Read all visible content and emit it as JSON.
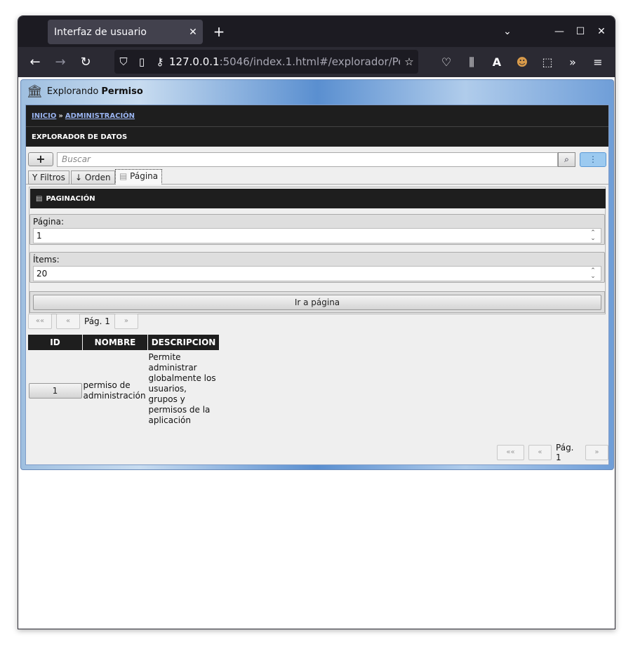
{
  "browser": {
    "tab_title": "Interfaz de usuario",
    "tab_close": "✕",
    "new_tab": "+",
    "url_host": "127.0.0.1",
    "url_rest": ":5046/index.1.html#/explorador/Pe"
  },
  "app": {
    "header_prefix": "Explorando",
    "header_entity": "Permiso",
    "breadcrumb": {
      "home": "INICIO",
      "separator": "»",
      "section": "ADMINISTRACIÓN"
    },
    "section_title": "EXPLORADOR DE DATOS",
    "search": {
      "add_label": "+",
      "placeholder": "Buscar",
      "more_label": "⋮"
    },
    "tabs": [
      {
        "label": "Filtros",
        "icon": "Y"
      },
      {
        "label": "Orden",
        "icon": "↓"
      },
      {
        "label": "Página",
        "icon": "▤"
      }
    ],
    "pagination": {
      "title": "PAGINACIÓN",
      "page_label": "Página:",
      "page_value": "1",
      "items_label": "Ítems:",
      "items_value": "20",
      "go_label": "Ir a página"
    },
    "pager": {
      "first": "««",
      "prev": "«",
      "current": "Pág. 1",
      "next": "»"
    },
    "table": {
      "columns": [
        "ID",
        "NOMBRE",
        "DESCRIPCION"
      ],
      "rows": [
        {
          "id": "1",
          "nombre_lines": [
            "permiso de",
            "administración"
          ],
          "descripcion_lines": [
            "Permite",
            "administrar",
            "globalmente los",
            "usuarios,",
            "grupos y",
            "permisos de la",
            "aplicación"
          ]
        }
      ]
    }
  }
}
